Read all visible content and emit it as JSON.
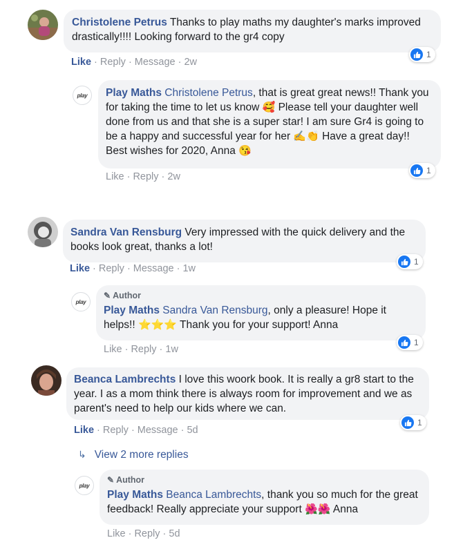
{
  "comments": [
    {
      "author": "Christolene Petrus",
      "text": " Thanks to play maths my daughter's marks improved drastically!!!! Looking forward to the gr4 copy",
      "actions": {
        "like": "Like",
        "reply": "Reply",
        "message": "Message",
        "time": "2w"
      },
      "reactions": "1",
      "reply": {
        "author": "Play Maths",
        "mention": "Christolene Petrus",
        "text_1": ", that is great great news!! Thank you for taking the time to let us know ",
        "emoji_1": "🥰",
        "text_2": " Please tell your daughter well done from us and that she is a super star! I am sure Gr4 is going to be a happy and successful year for her ",
        "emoji_2": "✍👏",
        "text_3": " Have a great day!! Best wishes for 2020, Anna ",
        "emoji_3": "😘",
        "actions": {
          "like": "Like",
          "reply": "Reply",
          "time": "2w"
        },
        "reactions": "1"
      }
    },
    {
      "author": "Sandra Van Rensburg",
      "text": " Very impressed with the quick delivery and the books look great, thanks a lot!",
      "actions": {
        "like": "Like",
        "reply": "Reply",
        "message": "Message",
        "time": "1w"
      },
      "reactions": "1",
      "reply": {
        "badge": "Author",
        "author": "Play Maths",
        "mention": "Sandra Van Rensburg",
        "text_1": ", only a pleasure! Hope it helps!! ",
        "emoji_1": "⭐⭐⭐",
        "text_2": " Thank you for your support! Anna",
        "actions": {
          "like": "Like",
          "reply": "Reply",
          "time": "1w"
        },
        "reactions": "1"
      }
    },
    {
      "author": "Beanca Lambrechts",
      "text": " I love this woork book. It is really a gr8 start to the year. I as a mom think there is always room for improvement and we as parent's need to help our kids where we can.",
      "actions": {
        "like": "Like",
        "reply": "Reply",
        "message": "Message",
        "time": "5d"
      },
      "reactions": "1",
      "more_replies": "View 2 more replies",
      "reply": {
        "badge": "Author",
        "author": "Play Maths",
        "mention": "Beanca Lambrechts",
        "text_1": ", thank you so much for the great feedback! Really appreciate your support ",
        "emoji_1": "🌺🌺",
        "text_2": " Anna",
        "actions": {
          "like": "Like",
          "reply": "Reply",
          "time": "5d"
        }
      }
    }
  ],
  "logo_text": "play",
  "colors": {
    "link": "#385898",
    "meta": "#90949c",
    "bubble": "#f2f3f5",
    "like_blue": "#1877f2"
  },
  "icons": {
    "like": "thumbs-up-icon",
    "author": "pencil-icon",
    "more": "reply-arrow-icon"
  }
}
